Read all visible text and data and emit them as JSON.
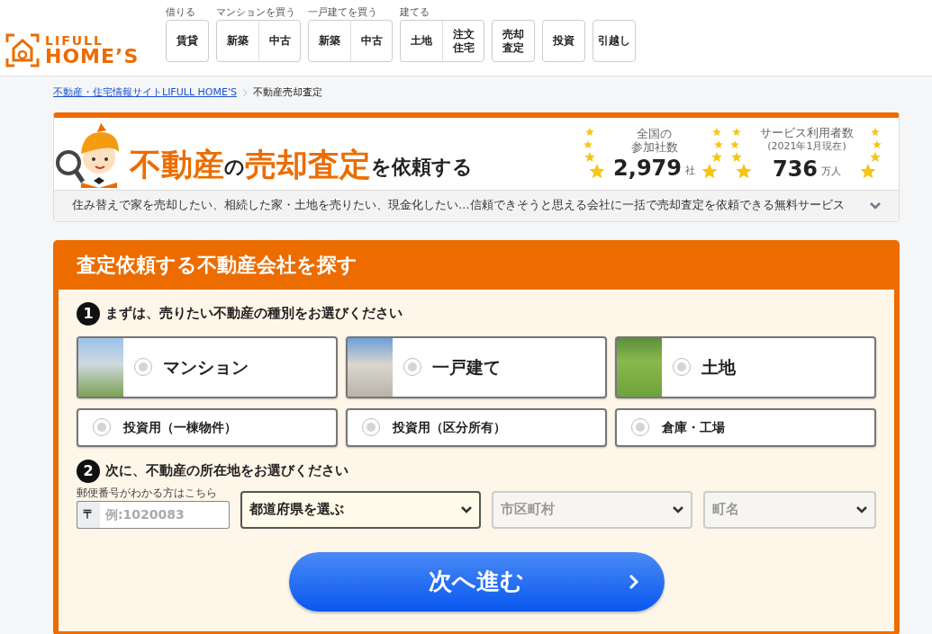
{
  "header": {
    "logo": {
      "line1": "LIFULL",
      "line2": "HOME’S"
    },
    "nav_groups": [
      {
        "label": "借りる",
        "buttons": [
          [
            "賃貸"
          ]
        ]
      },
      {
        "label": "マンションを買う",
        "buttons": [
          [
            "新築"
          ],
          [
            "中古"
          ]
        ]
      },
      {
        "label": "一戸建てを買う",
        "buttons": [
          [
            "新築"
          ],
          [
            "中古"
          ]
        ]
      },
      {
        "label": "建てる",
        "buttons": [
          [
            "土地"
          ],
          [
            "注文",
            "住宅"
          ]
        ]
      },
      {
        "buttons": [
          [
            "売却",
            "査定"
          ]
        ]
      },
      {
        "buttons": [
          [
            "投資"
          ]
        ]
      },
      {
        "buttons": [
          [
            "引越し"
          ]
        ]
      }
    ]
  },
  "breadcrumb": [
    {
      "text": "不動産・住宅情報サイトLIFULL HOME'S",
      "link": true
    },
    {
      "text": "不動産売却査定",
      "link": false
    }
  ],
  "banner": {
    "title_parts": [
      {
        "text": "不動産",
        "emphasis": true
      },
      {
        "text": "の",
        "emphasis": false
      },
      {
        "text": "売却査定",
        "emphasis": true
      },
      {
        "text": "を依頼する",
        "emphasis": false
      }
    ],
    "stats": [
      {
        "label": [
          "全国の",
          "参加社数"
        ],
        "value": "2,979",
        "unit": "社"
      },
      {
        "label": [
          "サービス利用者数"
        ],
        "note": "(2021年1月現在)",
        "value": "736",
        "unit": "万人"
      }
    ],
    "description": "住み替えで家を売却したい、相続した家・土地を売りたい、現金化したい…信頼できそうと思える会社に一括で売却査定を依頼できる無料サービス",
    "expanded": false
  },
  "form": {
    "title": "査定依頼する不動産会社を探す",
    "step1": {
      "number": "1",
      "text": "まずは、売りたい不動産の種別をお選びください"
    },
    "property_types": [
      {
        "label": "マンション",
        "kind": "photo",
        "selected": false
      },
      {
        "label": "一戸建て",
        "kind": "photo",
        "selected": false
      },
      {
        "label": "土地",
        "kind": "photo",
        "selected": false
      },
      {
        "label": "投資用（一棟物件）",
        "kind": "plain",
        "selected": false
      },
      {
        "label": "投資用（区分所有）",
        "kind": "plain",
        "selected": false
      },
      {
        "label": "倉庫・工場",
        "kind": "plain",
        "selected": false
      }
    ],
    "step2": {
      "number": "2",
      "text": "次に、不動産の所在地をお選びください"
    },
    "postal": {
      "label": "郵便番号がわかる方はこちら",
      "prefix": "〒",
      "placeholder": "例:1020083"
    },
    "selects": [
      {
        "value": "都道府県を選ぶ",
        "disabled": false
      },
      {
        "value": "市区町村",
        "disabled": true
      },
      {
        "value": "町名",
        "disabled": true
      }
    ],
    "submit": {
      "label": "次へ進む"
    }
  }
}
